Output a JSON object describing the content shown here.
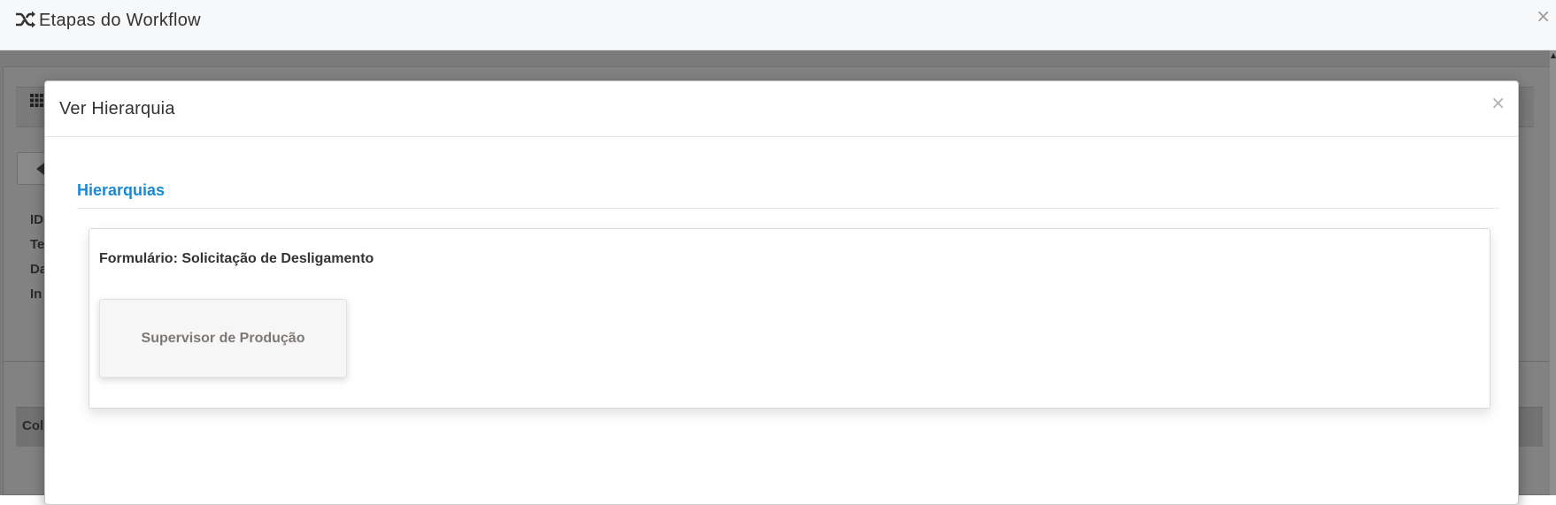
{
  "workflow": {
    "title": "Etapas do Workflow",
    "close_glyph": "×",
    "icon": "shuffle-icon"
  },
  "background": {
    "grid_icon": "grid-icon",
    "back_icon": "arrow-left-icon",
    "peek_labels": [
      "ID",
      "Te",
      "Da",
      "In"
    ],
    "footer_peek": "Col"
  },
  "modal": {
    "title": "Ver Hierarquia",
    "close_glyph": "×",
    "section_title": "Hierarquias",
    "form_title": "Formulário: Solicitação de Desligamento",
    "nodes": [
      {
        "label": "Supervisor de Produção"
      }
    ]
  },
  "colors": {
    "accent": "#1a8ad4",
    "overlay": "#7b7b7b",
    "node_bg": "#f7f6f6"
  }
}
